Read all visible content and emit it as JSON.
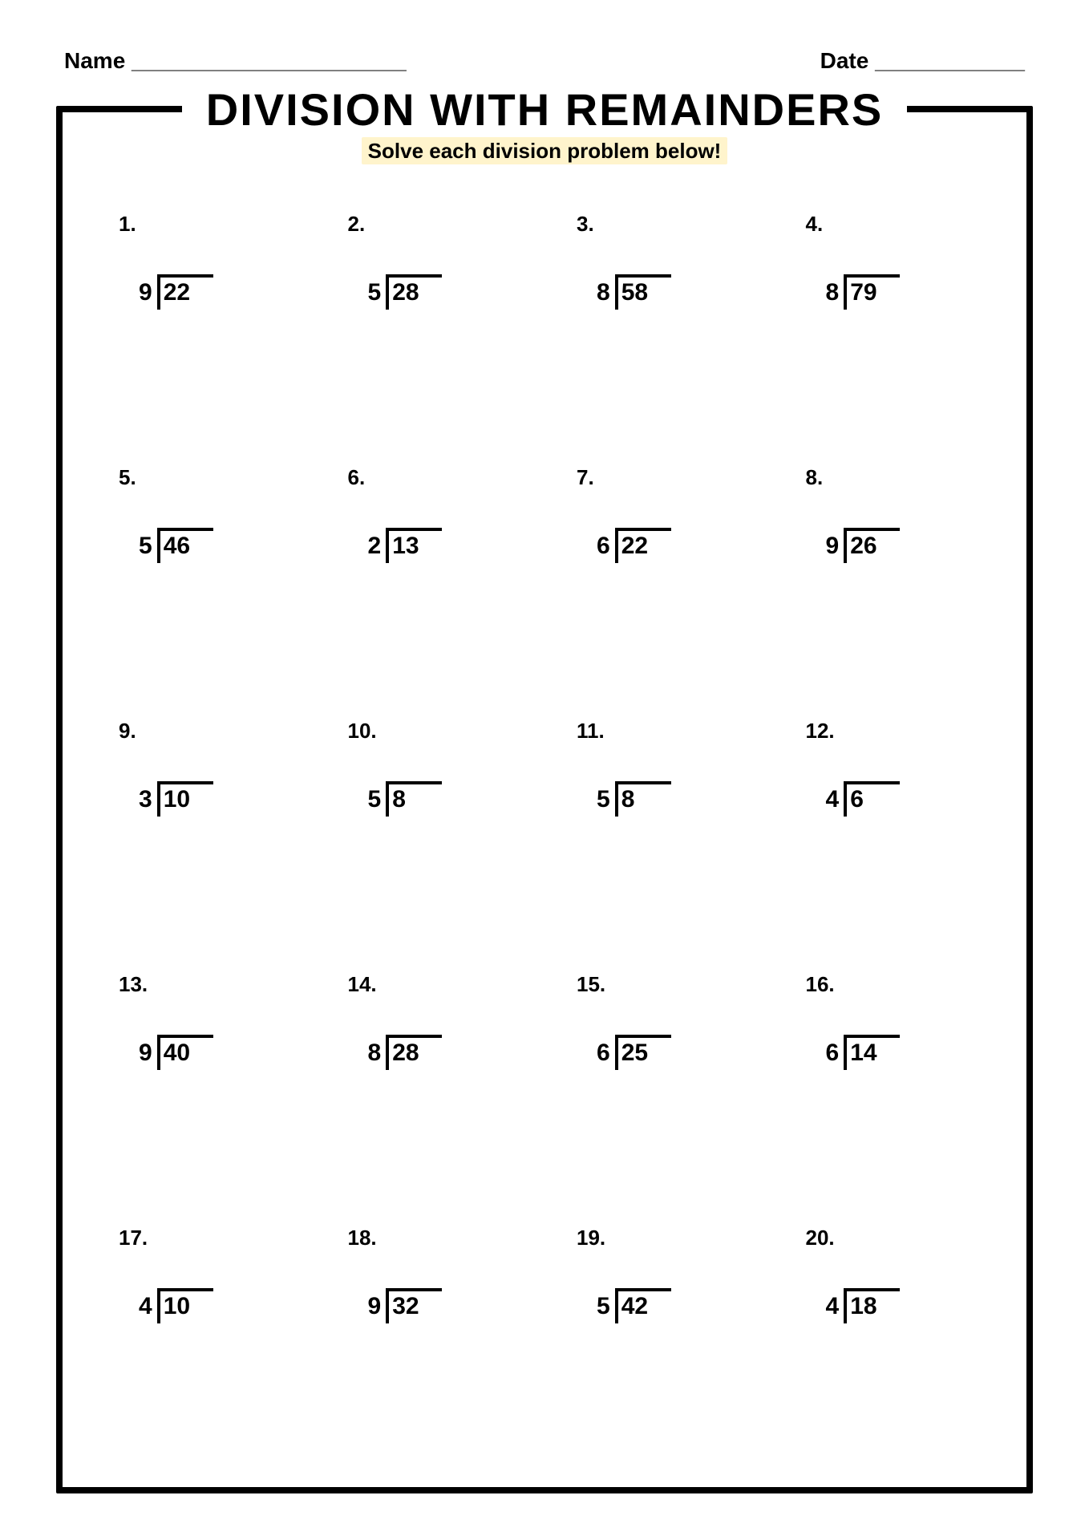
{
  "header": {
    "name_label": "Name",
    "name_blank": "______________________",
    "date_label": "Date",
    "date_blank": "____________"
  },
  "title": "DIVISION WITH REMAINDERS",
  "subtitle": "Solve each division problem below!",
  "problems": [
    {
      "num": "1.",
      "divisor": "9",
      "dividend": "22"
    },
    {
      "num": "2.",
      "divisor": "5",
      "dividend": "28"
    },
    {
      "num": "3.",
      "divisor": "8",
      "dividend": "58"
    },
    {
      "num": "4.",
      "divisor": "8",
      "dividend": "79"
    },
    {
      "num": "5.",
      "divisor": "5",
      "dividend": "46"
    },
    {
      "num": "6.",
      "divisor": "2",
      "dividend": "13"
    },
    {
      "num": "7.",
      "divisor": "6",
      "dividend": "22"
    },
    {
      "num": "8.",
      "divisor": "9",
      "dividend": "26"
    },
    {
      "num": "9.",
      "divisor": "3",
      "dividend": "10"
    },
    {
      "num": "10.",
      "divisor": "5",
      "dividend": "8"
    },
    {
      "num": "11.",
      "divisor": "5",
      "dividend": "8"
    },
    {
      "num": "12.",
      "divisor": "4",
      "dividend": "6"
    },
    {
      "num": "13.",
      "divisor": "9",
      "dividend": "40"
    },
    {
      "num": "14.",
      "divisor": "8",
      "dividend": "28"
    },
    {
      "num": "15.",
      "divisor": "6",
      "dividend": "25"
    },
    {
      "num": "16.",
      "divisor": "6",
      "dividend": "14"
    },
    {
      "num": "17.",
      "divisor": "4",
      "dividend": "10"
    },
    {
      "num": "18.",
      "divisor": "9",
      "dividend": "32"
    },
    {
      "num": "19.",
      "divisor": "5",
      "dividend": "42"
    },
    {
      "num": "20.",
      "divisor": "4",
      "dividend": "18"
    }
  ]
}
